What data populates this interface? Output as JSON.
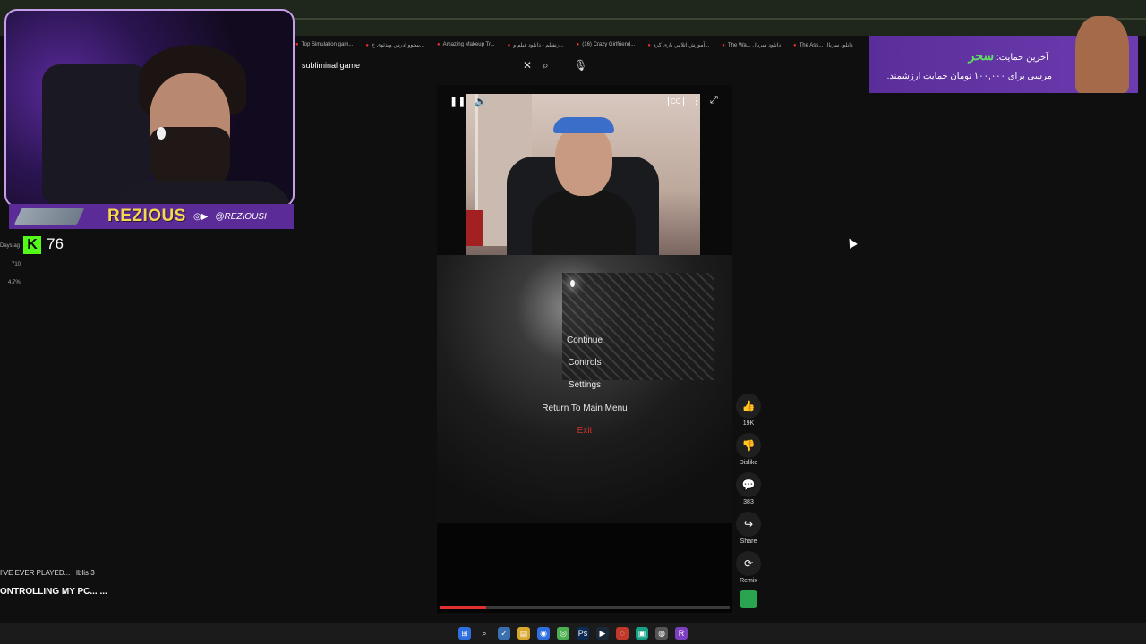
{
  "browser": {
    "bookmarks": [
      "Top Simulation gam...",
      "بیجوو ادرس ویدئوی خ...",
      "Amazing Makeup Tr...",
      "رنفیلم - دانلود فیلم و...",
      "(16) Crazy Girlfriend...",
      "آموزش اتلاس بازی کرد...",
      "The Wa... دانلود سریال",
      "The Ass... دانلود سریال"
    ]
  },
  "search": {
    "query": "subliminal game",
    "clear_icon": "✕",
    "search_icon": "⌕",
    "mic_icon": "🎙"
  },
  "stream_overlay": {
    "streamer_name": "REZIOUS",
    "social_handle": "@REZIOUSI",
    "viewer_count": "76",
    "side_stats": [
      "Days ag",
      "710",
      "4.7%"
    ]
  },
  "ad": {
    "line1_prefix": "آخرین حمایت:",
    "line1_name": "سحر",
    "line2": "مرسی برای ۱۰۰,۰۰۰ تومان حمایت ارزشمند."
  },
  "player": {
    "pause_icon": "❚❚",
    "volume_icon": "🔊",
    "cc_icon": "CC",
    "more_icon": "⋮",
    "fullscreen_icon": "⤢",
    "progress": 0.16
  },
  "game_menu": {
    "items": [
      "Continue",
      "Controls",
      "Settings",
      "Return To Main Menu"
    ],
    "exit": "Exit"
  },
  "actions": {
    "like": {
      "icon": "👍",
      "label": "19K"
    },
    "dislike": {
      "icon": "👎",
      "label": "Dislike"
    },
    "comments": {
      "icon": "💬",
      "label": "383"
    },
    "share": {
      "icon": "↪",
      "label": "Share"
    },
    "remix": {
      "icon": "⟳",
      "label": "Remix"
    }
  },
  "left_panel": {
    "title1": "I'VE EVER PLAYED... | Iblis 3",
    "title2": "ONTROLLING MY PC... ..."
  },
  "taskbar": {
    "icons": [
      "⊞",
      "⌕",
      "✓",
      "▤",
      "◉",
      "◎",
      "Ps",
      "▶",
      "◌",
      "▣",
      "◍",
      "R"
    ]
  }
}
